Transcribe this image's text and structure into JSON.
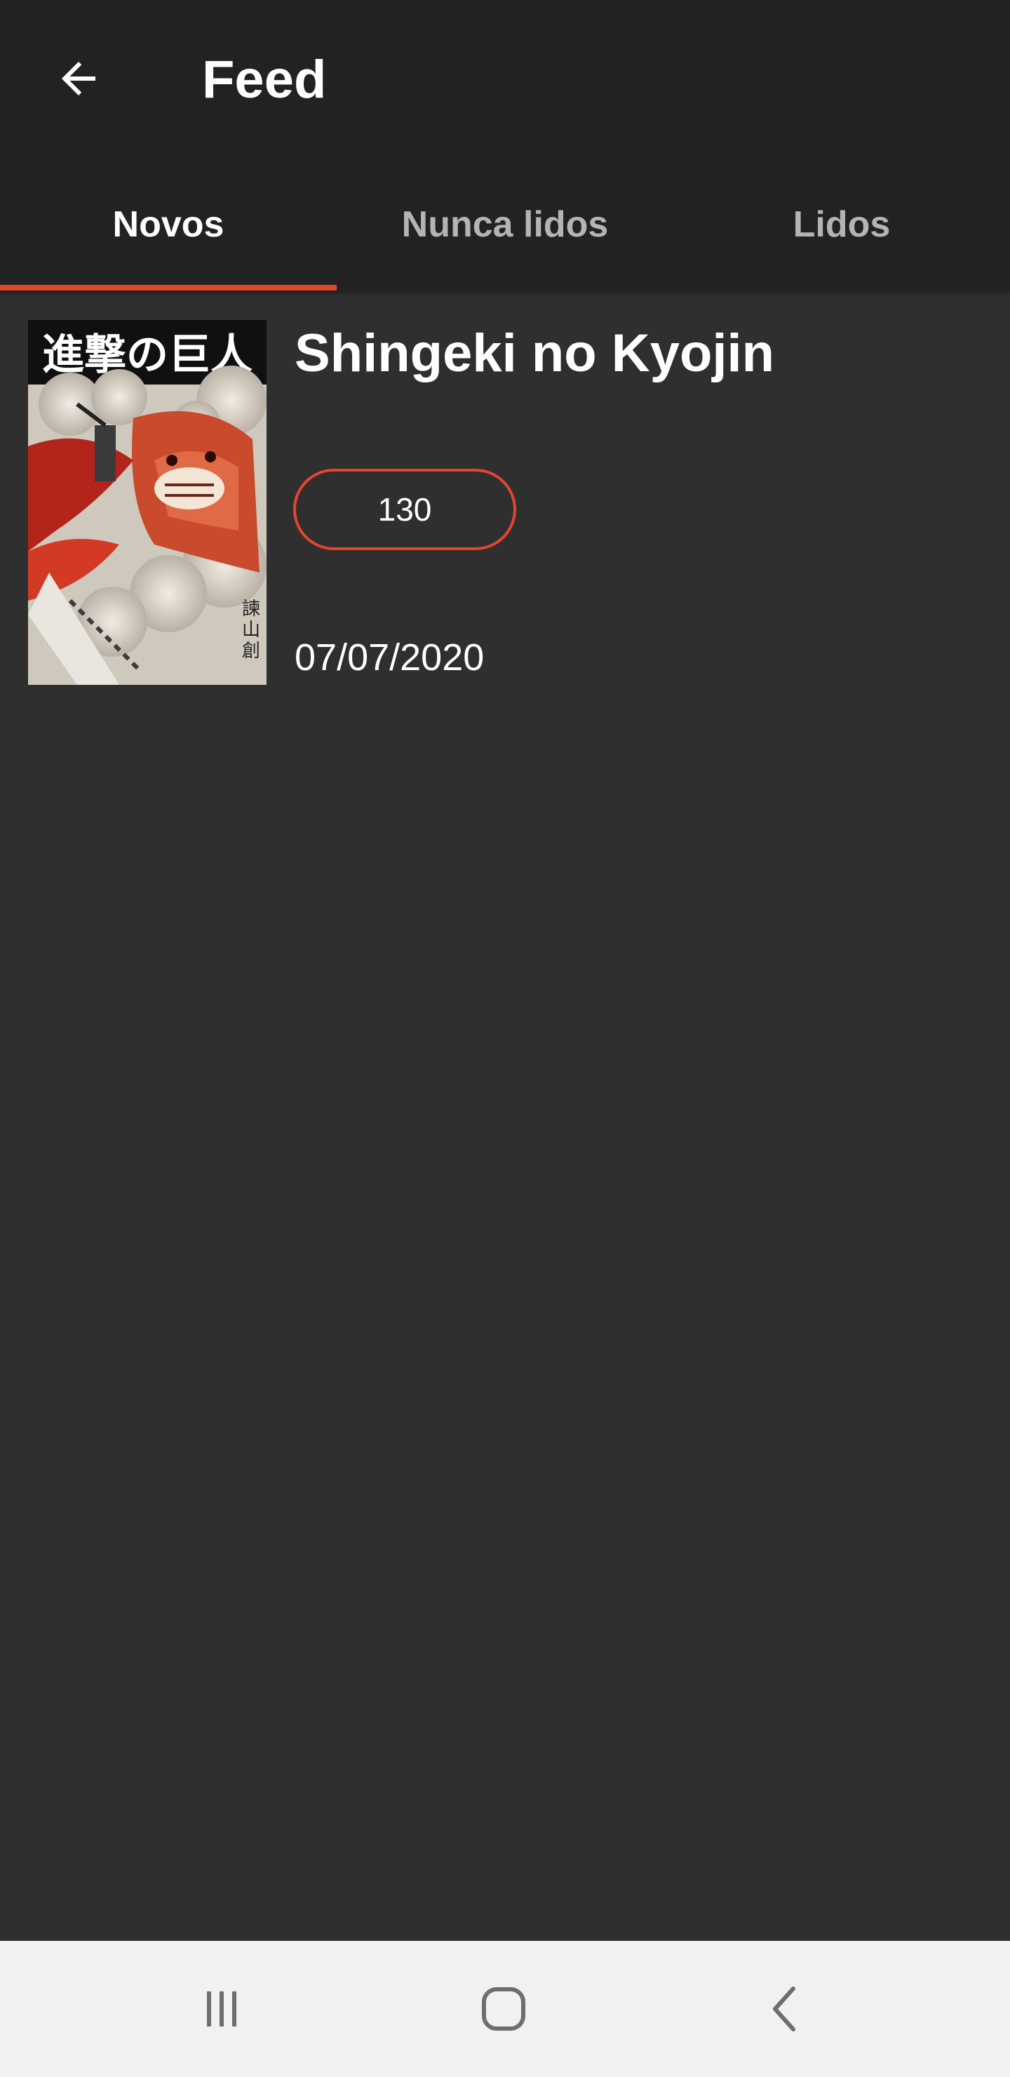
{
  "toolbar": {
    "title": "Feed",
    "back_icon": "arrow-left-icon"
  },
  "tabs": [
    {
      "label": "Novos",
      "active": true
    },
    {
      "label": "Nunca lidos",
      "active": false
    },
    {
      "label": "Lidos",
      "active": false
    }
  ],
  "feed": {
    "items": [
      {
        "title": "Shingeki no Kyojin",
        "chapter": "130",
        "date": "07/07/2020",
        "cover_title_art": "進撃の巨人"
      }
    ]
  },
  "system_nav": {
    "recents_icon": "recents-icon",
    "home_icon": "home-icon",
    "back_icon": "back-chevron-icon"
  },
  "colors": {
    "toolbar_bg": "#222222",
    "content_bg": "#2f2f2f",
    "accent": "#e4452e",
    "nav_bg": "#f1f1f1"
  }
}
